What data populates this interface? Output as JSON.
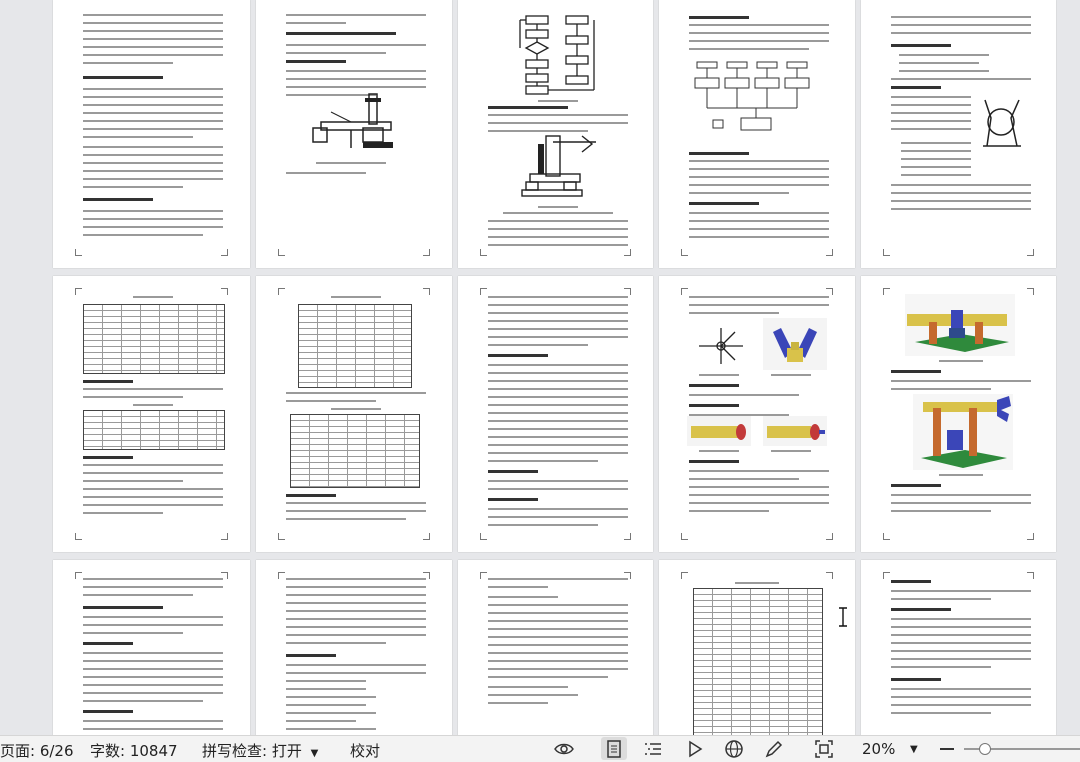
{
  "statusbar": {
    "page_label": "页面: 6/26",
    "word_count": "字数: 10847",
    "spellcheck": "拼写检查: 打开",
    "proofread": "校对",
    "zoom": "20%",
    "zoom_slider_level": 0.06
  },
  "pages": [
    {
      "section": "5.2 机械手运动参数的计算及设计"
    },
    {
      "section": "3 机械手各部件的功能和材料选择"
    },
    {
      "section": "图 3-1 机械手工作流程图"
    },
    {
      "section": "3.3 气缸设计"
    },
    {
      "section": "3.5 手部设计"
    },
    {
      "section": "表 3-1 运动参数表"
    },
    {
      "section": "表 3-2 气动元件参数"
    },
    {
      "section": "4 机械手的三维建模"
    },
    {
      "section": "图 4-1 手爪三维模型"
    },
    {
      "section": "图 4-5 机械手总体模型"
    },
    {
      "section": "5 PLC 控制系统的设计"
    },
    {
      "section": "5.2 PLC 选型"
    },
    {
      "section": "5.3 I/O 分配"
    },
    {
      "section": "表 5-1 I/O 分配表"
    },
    {
      "section": "6 结论"
    }
  ]
}
